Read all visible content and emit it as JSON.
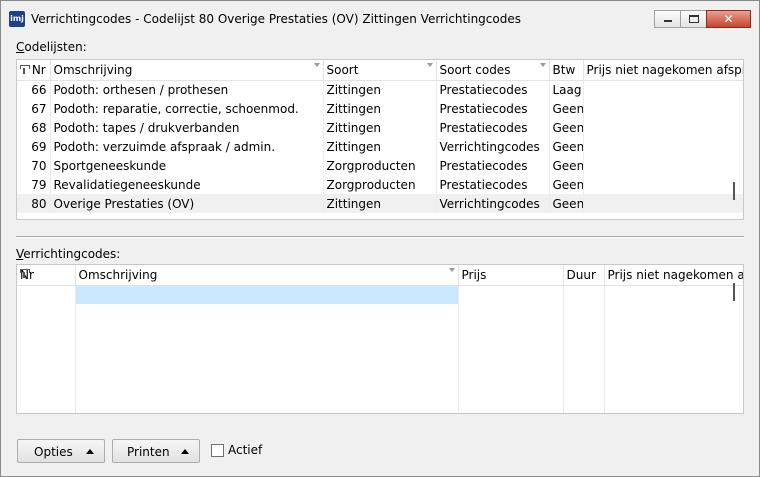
{
  "window": {
    "title": "Verrichtingcodes - Codelijst  80 Overige Prestaties (OV) Zittingen Verrichtingcodes",
    "icon": "imj-app-icon"
  },
  "codelijsten": {
    "label_underline": "C",
    "label_rest": "odelijsten:",
    "columns": [
      "Nr",
      "Omschrijving",
      "Soort",
      "Soort codes",
      "Btw",
      "Prijs niet nagekomen afspr"
    ],
    "rows": [
      {
        "nr": "66",
        "omschrijving": "Podoth: orthesen / prothesen",
        "soort": "Zittingen",
        "soort_codes": "Prestatiecodes",
        "btw": "Laag",
        "prijs": ""
      },
      {
        "nr": "67",
        "omschrijving": "Podoth: reparatie, correctie, schoenmod.",
        "soort": "Zittingen",
        "soort_codes": "Prestatiecodes",
        "btw": "Geen",
        "prijs": ""
      },
      {
        "nr": "68",
        "omschrijving": "Podoth: tapes / drukverbanden",
        "soort": "Zittingen",
        "soort_codes": "Prestatiecodes",
        "btw": "Geen",
        "prijs": ""
      },
      {
        "nr": "69",
        "omschrijving": "Podoth: verzuimde afspraak / admin.",
        "soort": "Zittingen",
        "soort_codes": "Verrichtingcodes",
        "btw": "Geen",
        "prijs": ""
      },
      {
        "nr": "70",
        "omschrijving": "Sportgeneeskunde",
        "soort": "Zorgproducten",
        "soort_codes": "Prestatiecodes",
        "btw": "Geen",
        "prijs": ""
      },
      {
        "nr": "79",
        "omschrijving": "Revalidatiegeneeskunde",
        "soort": "Zorgproducten",
        "soort_codes": "Prestatiecodes",
        "btw": "Geen",
        "prijs": ""
      },
      {
        "nr": "80",
        "omschrijving": "Overige Prestaties (OV)",
        "soort": "Zittingen",
        "soort_codes": "Verrichtingcodes",
        "btw": "Geen",
        "prijs": ""
      }
    ]
  },
  "verrichtingcodes": {
    "label_underline": "V",
    "label_rest": "errichtingcodes:",
    "columns": [
      "Nr",
      "Omschrijving",
      "Prijs",
      "Duur",
      "Prijs niet nagekomen a"
    ]
  },
  "footer": {
    "opties_label": "Opties",
    "printen_label": "Printen",
    "actief_label": "Actief",
    "actief_checked": false
  }
}
